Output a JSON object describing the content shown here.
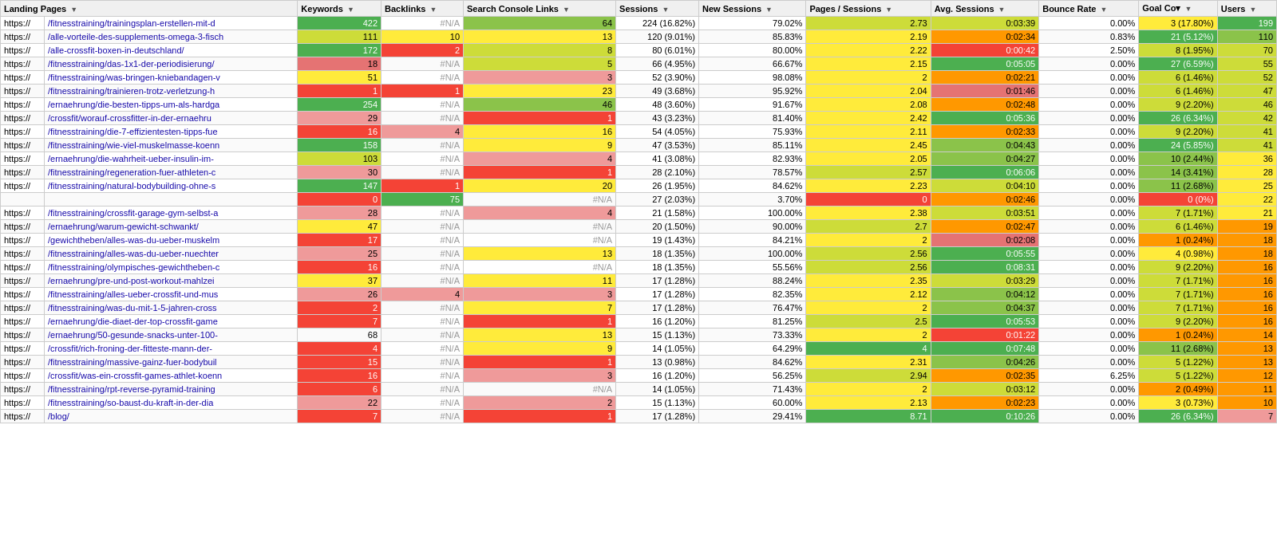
{
  "columns": [
    {
      "key": "urlBase",
      "label": "Landing Pages",
      "filter": true
    },
    {
      "key": "urlPath",
      "label": "",
      "filter": false
    },
    {
      "key": "keywords",
      "label": "Keywords",
      "filter": true
    },
    {
      "key": "backlinks",
      "label": "Backlinks",
      "filter": true
    },
    {
      "key": "searchConsole",
      "label": "Search Console Links",
      "filter": true
    },
    {
      "key": "sessions",
      "label": "Sessions",
      "filter": true
    },
    {
      "key": "newSessions",
      "label": "New Sessions",
      "filter": true
    },
    {
      "key": "pagesPerSession",
      "label": "Pages / Sessions",
      "filter": true
    },
    {
      "key": "avgSessions",
      "label": "Avg. Sessions",
      "filter": true
    },
    {
      "key": "bounceRate",
      "label": "Bounce Rate",
      "filter": true
    },
    {
      "key": "goalConv",
      "label": "Goal Co▾",
      "filter": true
    },
    {
      "key": "users",
      "label": "Users",
      "filter": true
    }
  ],
  "rows": [
    {
      "urlBase": "https://",
      "urlPath": "/fitnesstraining/trainingsplan-erstellen-mit-d",
      "keywords": "422",
      "keywordsColor": "bg-green-dark",
      "backlinks": "#N/A",
      "backlinksColor": "bg-white",
      "searchConsole": "64",
      "searchConsoleColor": "bg-green-med",
      "sessions": "224 (16.82%)",
      "newSessions": "79.02%",
      "pagesPerSession": "2.73",
      "avgSessions": "0:03:39",
      "avgColor": "bg-green-light",
      "bounceRate": "0.00%",
      "goalConv": "3 (17.80%)",
      "users": "199"
    },
    {
      "urlBase": "https://",
      "urlPath": "/alle-vorteile-des-supplements-omega-3-fisch",
      "keywords": "111",
      "keywordsColor": "bg-green-light",
      "backlinks": "10",
      "backlinksColor": "bg-yellow",
      "searchConsole": "13",
      "searchConsoleColor": "bg-yellow",
      "sessions": "120 (9.01%)",
      "newSessions": "85.83%",
      "pagesPerSession": "2.19",
      "avgSessions": "0:02:34",
      "avgColor": "bg-orange",
      "bounceRate": "0.83%",
      "goalConv": "21 (5.12%)",
      "users": "110"
    },
    {
      "urlBase": "https://",
      "urlPath": "/alle-crossfit-boxen-in-deutschland/",
      "keywords": "172",
      "keywordsColor": "bg-green-dark",
      "backlinks": "2",
      "backlinksColor": "bg-red",
      "searchConsole": "8",
      "searchConsoleColor": "bg-green-light",
      "sessions": "80 (6.01%)",
      "newSessions": "80.00%",
      "pagesPerSession": "2.22",
      "avgSessions": "0:00:42",
      "avgColor": "bg-red",
      "bounceRate": "2.50%",
      "goalConv": "8 (1.95%)",
      "users": "70"
    },
    {
      "urlBase": "https://",
      "urlPath": "/fitnesstraining/das-1x1-der-periodisierung/",
      "keywords": "18",
      "keywordsColor": "bg-red-med",
      "backlinks": "#N/A",
      "backlinksColor": "bg-white",
      "searchConsole": "5",
      "searchConsoleColor": "bg-green-light",
      "sessions": "66 (4.95%)",
      "newSessions": "66.67%",
      "pagesPerSession": "2.15",
      "avgSessions": "0:05:05",
      "avgColor": "bg-green-dark",
      "bounceRate": "0.00%",
      "goalConv": "27 (6.59%)",
      "users": "55"
    },
    {
      "urlBase": "https://",
      "urlPath": "/fitnesstraining/was-bringen-kniebandagen-v",
      "keywords": "51",
      "keywordsColor": "bg-yellow",
      "backlinks": "#N/A",
      "backlinksColor": "bg-white",
      "searchConsole": "3",
      "searchConsoleColor": "bg-red-light",
      "sessions": "52 (3.90%)",
      "newSessions": "98.08%",
      "pagesPerSession": "2",
      "avgSessions": "0:02:21",
      "avgColor": "bg-orange",
      "bounceRate": "0.00%",
      "goalConv": "6 (1.46%)",
      "users": "52"
    },
    {
      "urlBase": "https://",
      "urlPath": "/fitnesstraining/trainieren-trotz-verletzung-h",
      "keywords": "1",
      "keywordsColor": "bg-red",
      "backlinks": "1",
      "backlinksColor": "bg-red",
      "searchConsole": "23",
      "searchConsoleColor": "bg-yellow",
      "sessions": "49 (3.68%)",
      "newSessions": "95.92%",
      "pagesPerSession": "2.04",
      "avgSessions": "0:01:46",
      "avgColor": "bg-red-med",
      "bounceRate": "0.00%",
      "goalConv": "6 (1.46%)",
      "users": "47"
    },
    {
      "urlBase": "https://",
      "urlPath": "/ernaehrung/die-besten-tipps-um-als-hardga",
      "keywords": "254",
      "keywordsColor": "bg-green-dark",
      "backlinks": "#N/A",
      "backlinksColor": "bg-white",
      "searchConsole": "46",
      "searchConsoleColor": "bg-green-med",
      "sessions": "48 (3.60%)",
      "newSessions": "91.67%",
      "pagesPerSession": "2.08",
      "avgSessions": "0:02:48",
      "avgColor": "bg-orange",
      "bounceRate": "0.00%",
      "goalConv": "9 (2.20%)",
      "users": "46"
    },
    {
      "urlBase": "https://",
      "urlPath": "/crossfit/worauf-crossfitter-in-der-ernaehru",
      "keywords": "29",
      "keywordsColor": "bg-red-light",
      "backlinks": "#N/A",
      "backlinksColor": "bg-white",
      "searchConsole": "1",
      "searchConsoleColor": "bg-red",
      "sessions": "43 (3.23%)",
      "newSessions": "81.40%",
      "pagesPerSession": "2.42",
      "avgSessions": "0:05:36",
      "avgColor": "bg-green-dark",
      "bounceRate": "0.00%",
      "goalConv": "26 (6.34%)",
      "users": "42"
    },
    {
      "urlBase": "https://",
      "urlPath": "/fitnesstraining/die-7-effizientesten-tipps-fue",
      "keywords": "16",
      "keywordsColor": "bg-red",
      "backlinks": "4",
      "backlinksColor": "bg-red-light",
      "searchConsole": "16",
      "searchConsoleColor": "bg-yellow",
      "sessions": "54 (4.05%)",
      "newSessions": "75.93%",
      "pagesPerSession": "2.11",
      "avgSessions": "0:02:33",
      "avgColor": "bg-orange",
      "bounceRate": "0.00%",
      "goalConv": "9 (2.20%)",
      "users": "41"
    },
    {
      "urlBase": "https://",
      "urlPath": "/fitnesstraining/wie-viel-muskelmasse-koenn",
      "keywords": "158",
      "keywordsColor": "bg-green-dark",
      "backlinks": "#N/A",
      "backlinksColor": "bg-white",
      "searchConsole": "9",
      "searchConsoleColor": "bg-yellow",
      "sessions": "47 (3.53%)",
      "newSessions": "85.11%",
      "pagesPerSession": "2.45",
      "avgSessions": "0:04:43",
      "avgColor": "bg-green-med",
      "bounceRate": "0.00%",
      "goalConv": "24 (5.85%)",
      "users": "41"
    },
    {
      "urlBase": "https://",
      "urlPath": "/ernaehrung/die-wahrheit-ueber-insulin-im-",
      "keywords": "103",
      "keywordsColor": "bg-green-light",
      "backlinks": "#N/A",
      "backlinksColor": "bg-white",
      "searchConsole": "4",
      "searchConsoleColor": "bg-red-light",
      "sessions": "41 (3.08%)",
      "newSessions": "82.93%",
      "pagesPerSession": "2.05",
      "avgSessions": "0:04:27",
      "avgColor": "bg-green-med",
      "bounceRate": "0.00%",
      "goalConv": "10 (2.44%)",
      "users": "36"
    },
    {
      "urlBase": "https://",
      "urlPath": "/fitnesstraining/regeneration-fuer-athleten-c",
      "keywords": "30",
      "keywordsColor": "bg-red-light",
      "backlinks": "#N/A",
      "backlinksColor": "bg-white",
      "searchConsole": "1",
      "searchConsoleColor": "bg-red",
      "sessions": "28 (2.10%)",
      "newSessions": "78.57%",
      "pagesPerSession": "2.57",
      "avgSessions": "0:06:06",
      "avgColor": "bg-green-dark",
      "bounceRate": "0.00%",
      "goalConv": "14 (3.41%)",
      "users": "28"
    },
    {
      "urlBase": "https://",
      "urlPath": "/fitnesstraining/natural-bodybuilding-ohne-s",
      "keywords": "147",
      "keywordsColor": "bg-green-dark",
      "backlinks": "1",
      "backlinksColor": "bg-red",
      "searchConsole": "20",
      "searchConsoleColor": "bg-yellow",
      "sessions": "26 (1.95%)",
      "newSessions": "84.62%",
      "pagesPerSession": "2.23",
      "avgSessions": "0:04:10",
      "avgColor": "bg-green-light",
      "bounceRate": "0.00%",
      "goalConv": "11 (2.68%)",
      "users": "25"
    },
    {
      "urlBase": "",
      "urlPath": "",
      "keywords": "0",
      "keywordsColor": "bg-red",
      "backlinks": "75",
      "backlinksColor": "bg-green-dark",
      "searchConsole": "#N/A",
      "searchConsoleColor": "bg-white",
      "sessions": "27 (2.03%)",
      "newSessions": "3.70%",
      "pagesPerSession": "0",
      "avgSessions": "0:02:46",
      "avgColor": "bg-orange",
      "bounceRate": "0.00%",
      "goalConv": "0 (0%)",
      "users": "22"
    },
    {
      "urlBase": "https://",
      "urlPath": "/fitnesstraining/crossfit-garage-gym-selbst-a",
      "keywords": "28",
      "keywordsColor": "bg-red-light",
      "backlinks": "#N/A",
      "backlinksColor": "bg-white",
      "searchConsole": "4",
      "searchConsoleColor": "bg-red-light",
      "sessions": "21 (1.58%)",
      "newSessions": "100.00%",
      "pagesPerSession": "2.38",
      "avgSessions": "0:03:51",
      "avgColor": "bg-green-light",
      "bounceRate": "0.00%",
      "goalConv": "7 (1.71%)",
      "users": "21"
    },
    {
      "urlBase": "https://",
      "urlPath": "/ernaehrung/warum-gewicht-schwankt/",
      "keywords": "47",
      "keywordsColor": "bg-yellow",
      "backlinks": "#N/A",
      "backlinksColor": "bg-white",
      "searchConsole": "#N/A",
      "searchConsoleColor": "bg-white",
      "sessions": "20 (1.50%)",
      "newSessions": "90.00%",
      "pagesPerSession": "2.7",
      "avgSessions": "0:02:47",
      "avgColor": "bg-orange",
      "bounceRate": "0.00%",
      "goalConv": "6 (1.46%)",
      "users": "19"
    },
    {
      "urlBase": "https://",
      "urlPath": "/gewichtheben/alles-was-du-ueber-muskelm",
      "keywords": "17",
      "keywordsColor": "bg-red",
      "backlinks": "#N/A",
      "backlinksColor": "bg-white",
      "searchConsole": "#N/A",
      "searchConsoleColor": "bg-white",
      "sessions": "19 (1.43%)",
      "newSessions": "84.21%",
      "pagesPerSession": "2",
      "avgSessions": "0:02:08",
      "avgColor": "bg-red-med",
      "bounceRate": "0.00%",
      "goalConv": "1 (0.24%)",
      "users": "18"
    },
    {
      "urlBase": "https://",
      "urlPath": "/fitnesstraining/alles-was-du-ueber-nuechter",
      "keywords": "25",
      "keywordsColor": "bg-red-light",
      "backlinks": "#N/A",
      "backlinksColor": "bg-white",
      "searchConsole": "13",
      "searchConsoleColor": "bg-yellow",
      "sessions": "18 (1.35%)",
      "newSessions": "100.00%",
      "pagesPerSession": "2.56",
      "avgSessions": "0:05:55",
      "avgColor": "bg-green-dark",
      "bounceRate": "0.00%",
      "goalConv": "4 (0.98%)",
      "users": "18"
    },
    {
      "urlBase": "https://",
      "urlPath": "/fitnesstraining/olympisches-gewichtheben-c",
      "keywords": "16",
      "keywordsColor": "bg-red",
      "backlinks": "#N/A",
      "backlinksColor": "bg-white",
      "searchConsole": "#N/A",
      "searchConsoleColor": "bg-white",
      "sessions": "18 (1.35%)",
      "newSessions": "55.56%",
      "pagesPerSession": "2.56",
      "avgSessions": "0:08:31",
      "avgColor": "bg-green-dark",
      "bounceRate": "0.00%",
      "goalConv": "9 (2.20%)",
      "users": "16"
    },
    {
      "urlBase": "https://",
      "urlPath": "/ernaehrung/pre-und-post-workout-mahlzei",
      "keywords": "37",
      "keywordsColor": "bg-yellow",
      "backlinks": "#N/A",
      "backlinksColor": "bg-white",
      "searchConsole": "11",
      "searchConsoleColor": "bg-yellow",
      "sessions": "17 (1.28%)",
      "newSessions": "88.24%",
      "pagesPerSession": "2.35",
      "avgSessions": "0:03:29",
      "avgColor": "bg-green-light",
      "bounceRate": "0.00%",
      "goalConv": "7 (1.71%)",
      "users": "16"
    },
    {
      "urlBase": "https://",
      "urlPath": "/fitnesstraining/alles-ueber-crossfit-und-mus",
      "keywords": "26",
      "keywordsColor": "bg-red-light",
      "backlinks": "4",
      "backlinksColor": "bg-red-light",
      "searchConsole": "3",
      "searchConsoleColor": "bg-red-light",
      "sessions": "17 (1.28%)",
      "newSessions": "82.35%",
      "pagesPerSession": "2.12",
      "avgSessions": "0:04:12",
      "avgColor": "bg-green-med",
      "bounceRate": "0.00%",
      "goalConv": "7 (1.71%)",
      "users": "16"
    },
    {
      "urlBase": "https://",
      "urlPath": "/fitnesstraining/was-du-mit-1-5-jahren-cross",
      "keywords": "2",
      "keywordsColor": "bg-red",
      "backlinks": "#N/A",
      "backlinksColor": "bg-white",
      "searchConsole": "7",
      "searchConsoleColor": "bg-yellow",
      "sessions": "17 (1.28%)",
      "newSessions": "76.47%",
      "pagesPerSession": "2",
      "avgSessions": "0:04:37",
      "avgColor": "bg-green-med",
      "bounceRate": "0.00%",
      "goalConv": "7 (1.71%)",
      "users": "16"
    },
    {
      "urlBase": "https://",
      "urlPath": "/ernaehrung/die-diaet-der-top-crossfit-game",
      "keywords": "7",
      "keywordsColor": "bg-red",
      "backlinks": "#N/A",
      "backlinksColor": "bg-white",
      "searchConsole": "1",
      "searchConsoleColor": "bg-red",
      "sessions": "16 (1.20%)",
      "newSessions": "81.25%",
      "pagesPerSession": "2.5",
      "avgSessions": "0:05:53",
      "avgColor": "bg-green-dark",
      "bounceRate": "0.00%",
      "goalConv": "9 (2.20%)",
      "users": "16"
    },
    {
      "urlBase": "https://",
      "urlPath": "/ernaehrung/50-gesunde-snacks-unter-100-",
      "keywords": "68",
      "keyworksColor": "bg-green-light",
      "backlinks": "#N/A",
      "backlinksColor": "bg-white",
      "searchConsole": "13",
      "searchConsoleColor": "bg-yellow",
      "sessions": "15 (1.13%)",
      "newSessions": "73.33%",
      "pagesPerSession": "2",
      "avgSessions": "0:01:22",
      "avgColor": "bg-red",
      "bounceRate": "0.00%",
      "goalConv": "1 (0.24%)",
      "users": "14"
    },
    {
      "urlBase": "https://",
      "urlPath": "/crossfit/rich-froning-der-fitteste-mann-der-",
      "keywords": "4",
      "keywordsColor": "bg-red",
      "backlinks": "#N/A",
      "backlinksColor": "bg-white",
      "searchConsole": "9",
      "searchConsoleColor": "bg-yellow",
      "sessions": "14 (1.05%)",
      "newSessions": "64.29%",
      "pagesPerSession": "4",
      "avgSessions": "0:07:48",
      "avgColor": "bg-green-dark",
      "bounceRate": "0.00%",
      "goalConv": "11 (2.68%)",
      "users": "13"
    },
    {
      "urlBase": "https://",
      "urlPath": "/fitnesstraining/massive-gainz-fuer-bodybuil",
      "keywords": "15",
      "keywordsColor": "bg-red",
      "backlinks": "#N/A",
      "backlinksColor": "bg-white",
      "searchConsole": "1",
      "searchConsoleColor": "bg-red",
      "sessions": "13 (0.98%)",
      "newSessions": "84.62%",
      "pagesPerSession": "2.31",
      "avgSessions": "0:04:26",
      "avgColor": "bg-green-med",
      "bounceRate": "0.00%",
      "goalConv": "5 (1.22%)",
      "users": "13"
    },
    {
      "urlBase": "https://",
      "urlPath": "/crossfit/was-ein-crossfit-games-athlet-koenn",
      "keywords": "16",
      "keywordsColor": "bg-red",
      "backlinks": "#N/A",
      "backlinksColor": "bg-white",
      "searchConsole": "3",
      "searchConsoleColor": "bg-red-light",
      "sessions": "16 (1.20%)",
      "newSessions": "56.25%",
      "pagesPerSession": "2.94",
      "avgSessions": "0:02:35",
      "avgColor": "bg-orange",
      "bounceRate": "6.25%",
      "goalConv": "5 (1.22%)",
      "users": "12"
    },
    {
      "urlBase": "https://",
      "urlPath": "/fitnesstraining/rpt-reverse-pyramid-training",
      "keywords": "6",
      "keywordsColor": "bg-red",
      "backlinks": "#N/A",
      "backlinksColor": "bg-white",
      "searchConsole": "#N/A",
      "searchConsoleColor": "bg-white",
      "sessions": "14 (1.05%)",
      "newSessions": "71.43%",
      "pagesPerSession": "2",
      "avgSessions": "0:03:12",
      "avgColor": "bg-green-light",
      "bounceRate": "0.00%",
      "goalConv": "2 (0.49%)",
      "users": "11"
    },
    {
      "urlBase": "https://",
      "urlPath": "/fitnesstraining/so-baust-du-kraft-in-der-dia",
      "keywords": "22",
      "keywordsColor": "bg-red-light",
      "backlinks": "#N/A",
      "backlinksColor": "bg-white",
      "searchConsole": "2",
      "searchConsoleColor": "bg-red-light",
      "sessions": "15 (1.13%)",
      "newSessions": "60.00%",
      "pagesPerSession": "2.13",
      "avgSessions": "0:02:23",
      "avgColor": "bg-orange",
      "bounceRate": "0.00%",
      "goalConv": "3 (0.73%)",
      "users": "10"
    },
    {
      "urlBase": "https://",
      "urlPath": "/blog/",
      "keywords": "7",
      "keywordsColor": "bg-red",
      "backlinks": "#N/A",
      "backlinksColor": "bg-white",
      "searchConsole": "1",
      "searchConsoleColor": "bg-red",
      "sessions": "17 (1.28%)",
      "newSessions": "29.41%",
      "pagesPerSession": "8.71",
      "avgSessions": "0:10:26",
      "avgColor": "bg-green-dark",
      "bounceRate": "0.00%",
      "goalConv": "26 (6.34%)",
      "users": "7"
    }
  ]
}
